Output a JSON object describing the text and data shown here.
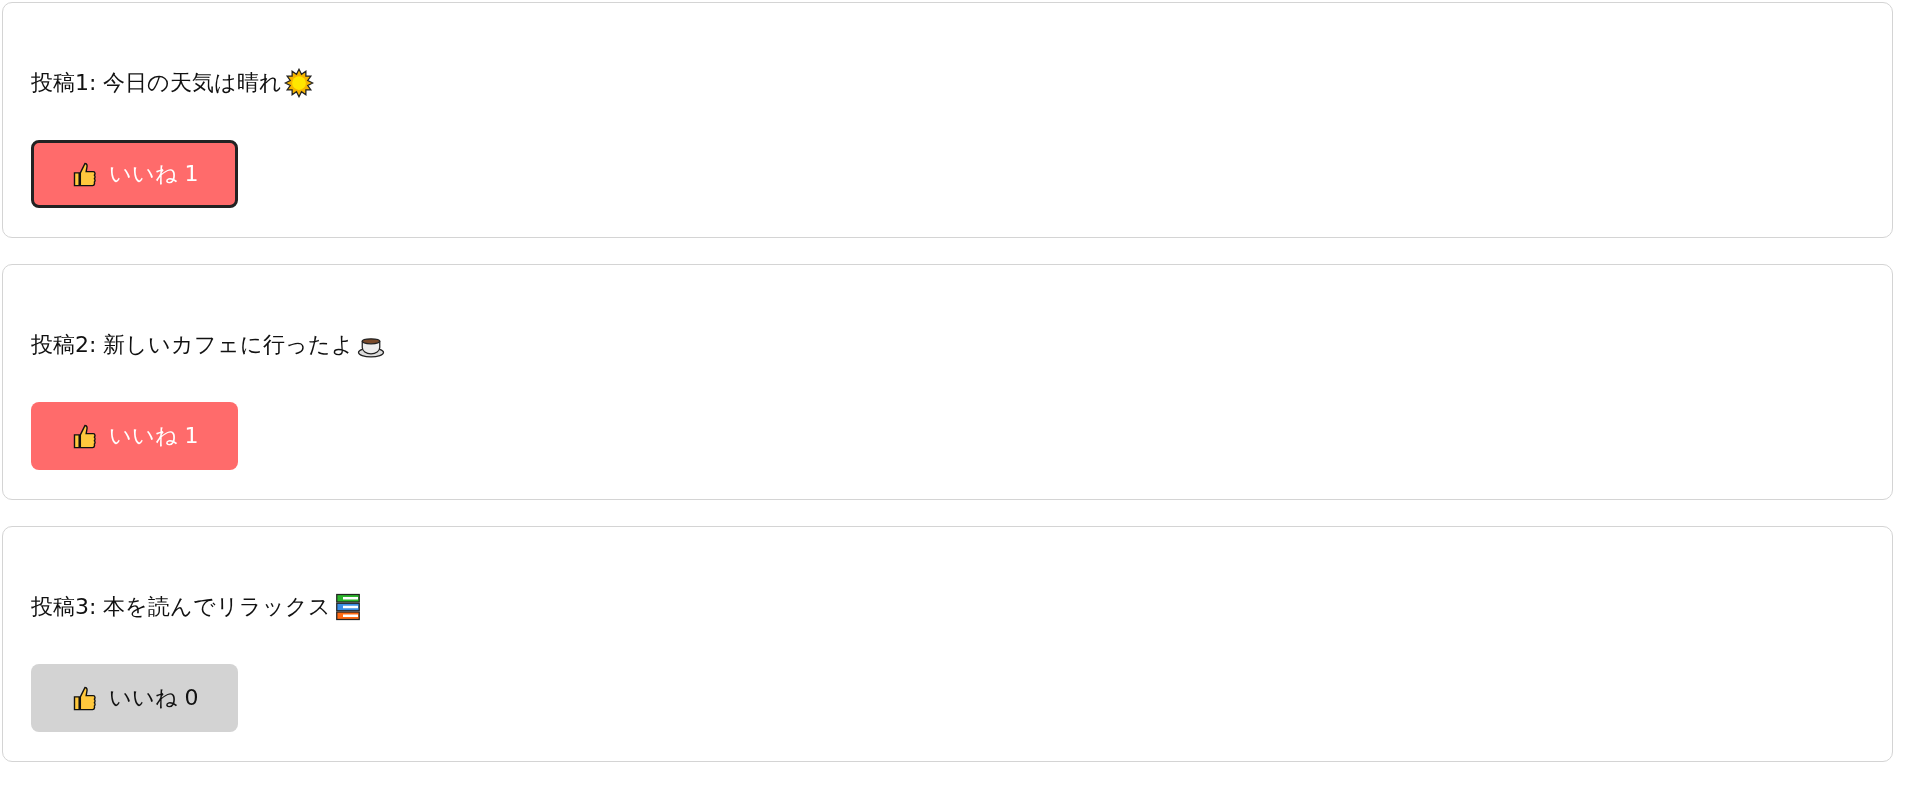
{
  "posts": [
    {
      "text": "投稿1: 今日の天気は晴れ",
      "kind": "sun",
      "like": {
        "label": "いいね",
        "count": "1",
        "liked": true,
        "focused": true
      }
    },
    {
      "text": "投稿2: 新しいカフェに行ったよ",
      "kind": "coffee",
      "like": {
        "label": "いいね",
        "count": "1",
        "liked": true,
        "focused": false
      }
    },
    {
      "text": "投稿3: 本を読んでリラックス",
      "kind": "books",
      "like": {
        "label": "いいね",
        "count": "0",
        "liked": false,
        "focused": false
      }
    }
  ]
}
